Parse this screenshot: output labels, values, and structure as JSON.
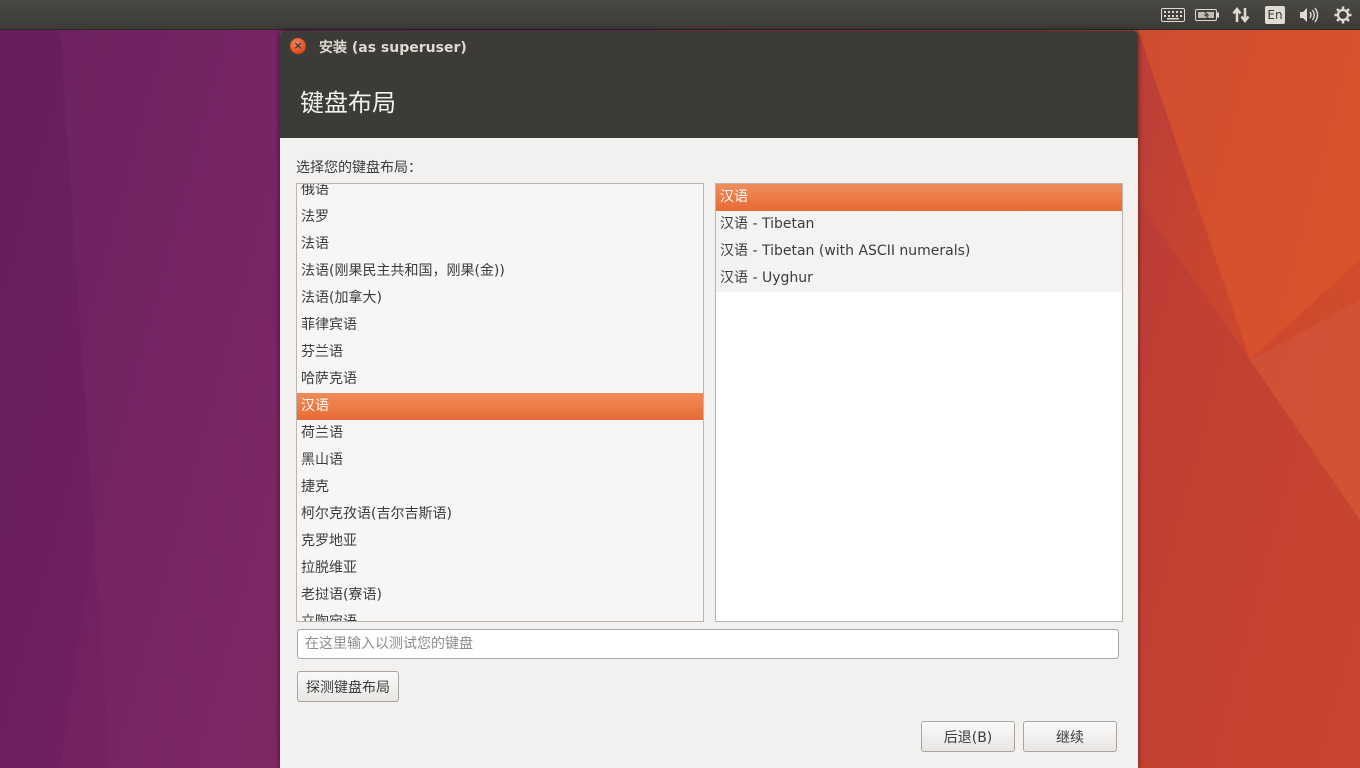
{
  "topbar": {
    "indicators": [
      {
        "icon": "keyboard-icon",
        "glyph": "⌨"
      },
      {
        "icon": "battery-icon",
        "glyph": "▭"
      },
      {
        "icon": "network-icon",
        "glyph": "⇅"
      },
      {
        "icon": "input-language-icon",
        "label": "En"
      },
      {
        "icon": "volume-icon",
        "glyph": "🔊"
      },
      {
        "icon": "system-gear-icon",
        "glyph": "⚙"
      }
    ]
  },
  "window": {
    "title": "安装 (as superuser)",
    "heading": "键盘布局",
    "prompt": "选择您的键盘布局：",
    "layouts": [
      {
        "label": "俄语"
      },
      {
        "label": "法罗"
      },
      {
        "label": "法语"
      },
      {
        "label": "法语(刚果民主共和国，刚果(金))"
      },
      {
        "label": "法语(加拿大)"
      },
      {
        "label": "菲律宾语"
      },
      {
        "label": "芬兰语"
      },
      {
        "label": "哈萨克语"
      },
      {
        "label": "汉语",
        "selected": true
      },
      {
        "label": "荷兰语"
      },
      {
        "label": "黑山语"
      },
      {
        "label": "捷克"
      },
      {
        "label": "柯尔克孜语(吉尔吉斯语)"
      },
      {
        "label": "克罗地亚"
      },
      {
        "label": "拉脱维亚"
      },
      {
        "label": "老挝语(寮语)"
      },
      {
        "label": "立陶宛语"
      }
    ],
    "variants": [
      {
        "label": "汉语",
        "selected": true
      },
      {
        "label": "汉语 - Tibetan"
      },
      {
        "label": "汉语 - Tibetan (with ASCII numerals)"
      },
      {
        "label": "汉语 - Uyghur"
      }
    ],
    "test_input": {
      "value": "",
      "placeholder": "在这里输入以测试您的键盘"
    },
    "detect_button": "探测键盘布局",
    "back_button": "后退(B)",
    "continue_button": "继续"
  }
}
